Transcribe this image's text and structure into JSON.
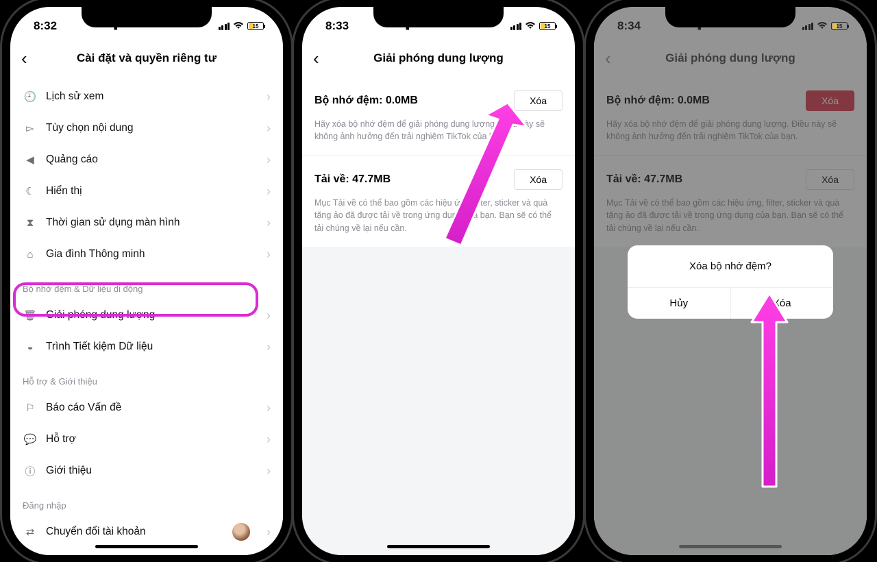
{
  "status": {
    "t1": "8:32",
    "t2": "8:33",
    "t3": "8:34",
    "battery": "15"
  },
  "s1": {
    "title": "Cài đặt và quyền riêng tư",
    "rows": {
      "history": "Lịch sử xem",
      "content": "Tùy chọn nội dung",
      "ads": "Quảng cáo",
      "display": "Hiển thị",
      "screentime": "Thời gian sử dụng màn hình",
      "family": "Gia đình Thông minh"
    },
    "sect_cache": "Bộ nhớ đệm & Dữ liệu di động",
    "rows2": {
      "free": "Giải phóng dung lượng",
      "saver": "Trình Tiết kiệm Dữ liệu"
    },
    "sect_help": "Hỗ trợ & Giới thiệu",
    "rows3": {
      "report": "Báo cáo Vấn đề",
      "support": "Hỗ trợ",
      "about": "Giới thiệu"
    },
    "sect_login": "Đăng nhập",
    "switch": "Chuyển đổi tài khoản"
  },
  "s2": {
    "title": "Giải phóng dung lượng",
    "cache_label": "Bộ nhớ đệm: 0.0MB",
    "clear": "Xóa",
    "cache_desc": "Hãy xóa bộ nhớ đệm để giải phóng dung lượng. Điều này sẽ không ảnh hưởng đến trải nghiệm TikTok của bạn.",
    "dl_label": "Tải về: 47.7MB",
    "dl_desc": "Mục Tải về có thể bao gồm các hiệu ứng, filter, sticker và quà tặng ảo đã được tải về trong ứng dụng của bạn. Bạn sẽ có thể tải chúng về lại nếu cần."
  },
  "s3": {
    "modal_title": "Xóa bộ nhớ đệm?",
    "cancel": "Hủy",
    "confirm": "Xóa"
  }
}
